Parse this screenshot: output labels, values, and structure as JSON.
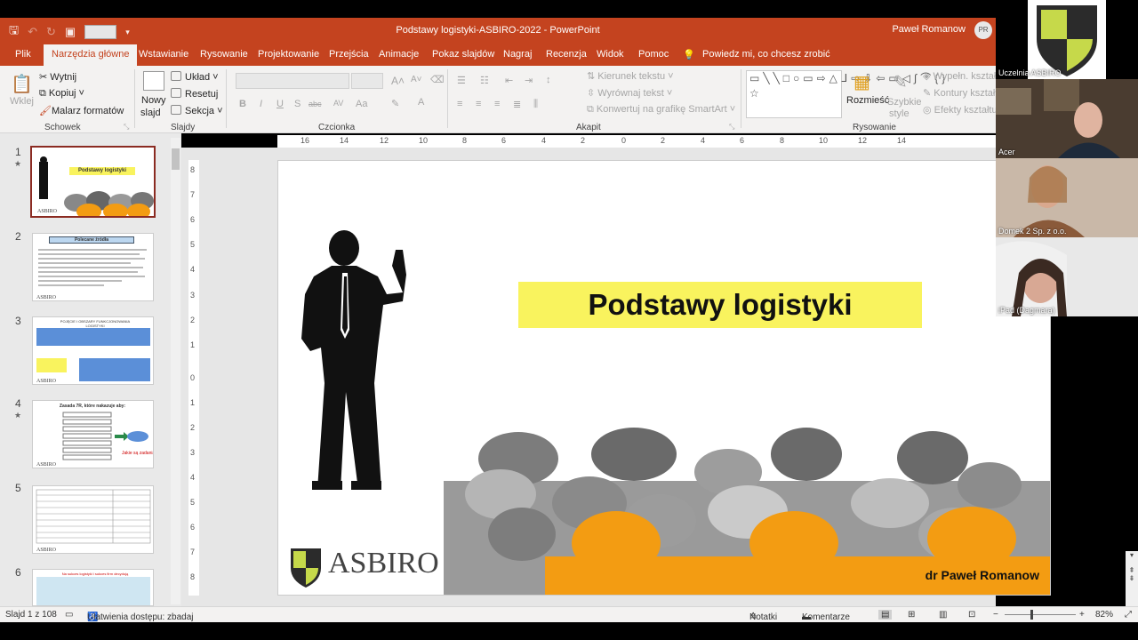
{
  "app": {
    "window_title": "Podstawy logistyki-ASBIRO-2022  -  PowerPoint",
    "user_name": "Paweł Romanow",
    "user_initials": "PR",
    "accent_color": "#c4431f"
  },
  "tabs": [
    "Plik",
    "Narzędzia główne",
    "Wstawianie",
    "Rysowanie",
    "Projektowanie",
    "Przejścia",
    "Animacje",
    "Pokaz slajdów",
    "Nagraj",
    "Recenzja",
    "Widok",
    "Pomoc"
  ],
  "active_tab": "Narzędzia główne",
  "tell_me": "Powiedz mi, co chcesz zrobić",
  "ribbon": {
    "clipboard": {
      "paste": "Wklej",
      "cut": "Wytnij",
      "copy": "Kopiuj",
      "format_painter": "Malarz formatów",
      "group": "Schowek"
    },
    "slides": {
      "new_slide_1": "Nowy",
      "new_slide_2": "slajd",
      "layout": "Układ",
      "reset": "Resetuj",
      "section": "Sekcja",
      "group": "Slajdy"
    },
    "font": {
      "group": "Czcionka"
    },
    "paragraph": {
      "text_direction": "Kierunek tekstu",
      "align_text": "Wyrównaj tekst",
      "smartart": "Konwertuj na grafikę SmartArt",
      "group": "Akapit"
    },
    "drawing": {
      "arrange": "Rozmieść",
      "quick_styles_1": "Szybkie",
      "quick_styles_2": "style",
      "fill": "Wypełn. kształtu",
      "outline": "Kontury kształtu",
      "effects": "Efekty kształtu",
      "group": "Rysowanie"
    }
  },
  "ruler_h": [
    "16",
    "14",
    "12",
    "10",
    "8",
    "6",
    "4",
    "2",
    "0",
    "2",
    "4",
    "6",
    "8",
    "10",
    "12",
    "14"
  ],
  "ruler_v": [
    "8",
    "7",
    "6",
    "5",
    "4",
    "3",
    "2",
    "1",
    "0",
    "1",
    "2",
    "3",
    "4",
    "5",
    "6",
    "7",
    "8"
  ],
  "thumbnails": [
    {
      "num": "1",
      "star": "★",
      "title": "Podstawy logistyki"
    },
    {
      "num": "2",
      "star": "",
      "title": "Polecane źródła"
    },
    {
      "num": "3",
      "star": "",
      "title": "POJĘCIE I OBSZARY FUNKCJONOWANIA LOGISTYKI"
    },
    {
      "num": "4",
      "star": "★",
      "title": "Zasada 7R, które nakazuje aby:"
    },
    {
      "num": "5",
      "star": "",
      "title": ""
    },
    {
      "num": "6",
      "star": "",
      "title": "Na sukces logistyki i sukces firm decydują"
    }
  ],
  "slide": {
    "title": "Podstawy logistyki",
    "author": "dr Paweł Romanow",
    "logo": "ASBIRO"
  },
  "status": {
    "slide_counter": "Slajd 1 z 108",
    "accessibility": "Ułatwienia dostępu: zbadaj",
    "notes": "Notatki",
    "comments": "Komentarze",
    "zoom": "82%"
  },
  "participants": [
    {
      "name": "Uczelnia ASBIRO"
    },
    {
      "name": "Acer"
    },
    {
      "name": "Domek 2 Sp. z o.o."
    },
    {
      "name": "iPad (Dagmara)"
    }
  ]
}
